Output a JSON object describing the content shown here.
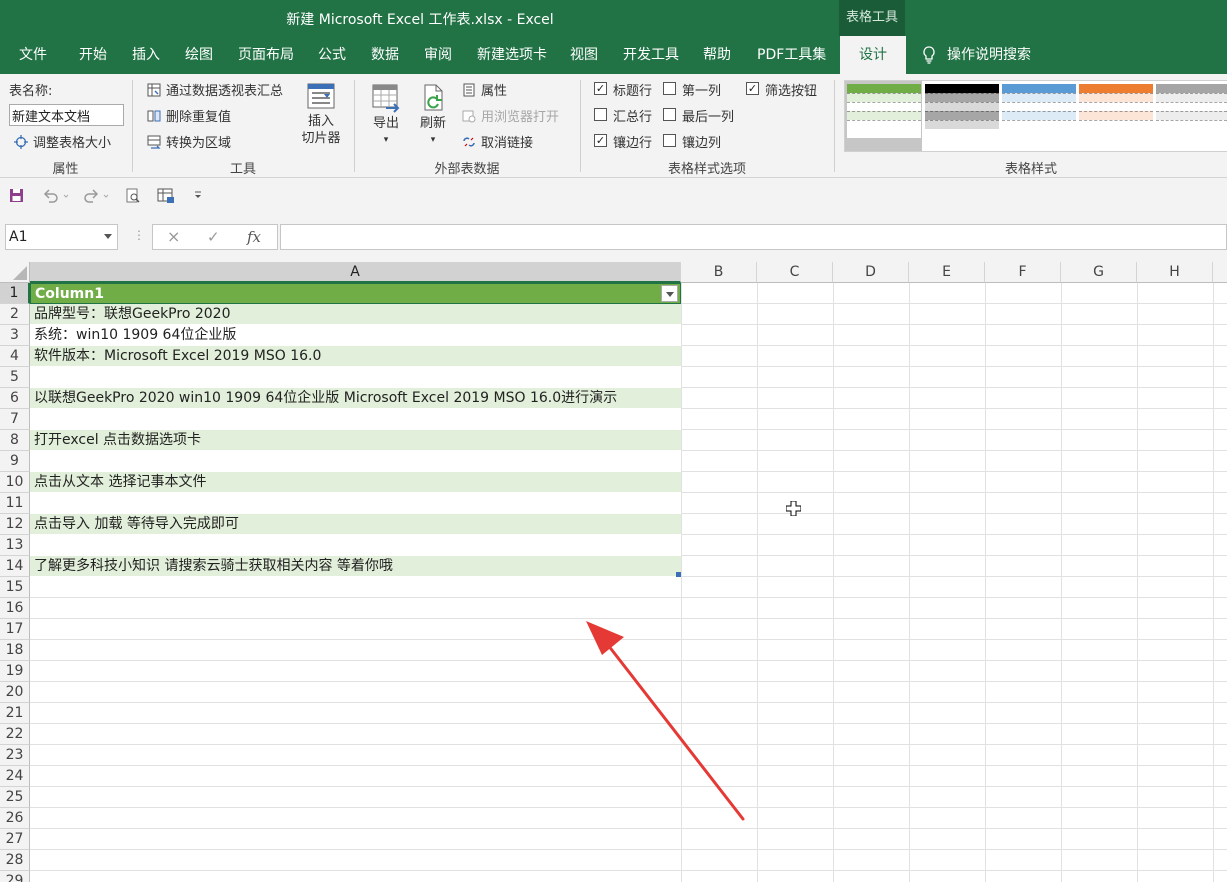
{
  "titlebar": {
    "title": "新建 Microsoft Excel 工作表.xlsx  -  Excel",
    "context_tab": "表格工具"
  },
  "tabs": [
    {
      "label": "文件"
    },
    {
      "label": "开始"
    },
    {
      "label": "插入"
    },
    {
      "label": "绘图"
    },
    {
      "label": "页面布局"
    },
    {
      "label": "公式"
    },
    {
      "label": "数据"
    },
    {
      "label": "审阅"
    },
    {
      "label": "新建选项卡"
    },
    {
      "label": "视图"
    },
    {
      "label": "开发工具"
    },
    {
      "label": "帮助"
    },
    {
      "label": "PDF工具集"
    },
    {
      "label": "设计"
    }
  ],
  "tell_me": "操作说明搜索",
  "ribbon": {
    "properties": {
      "name_label": "表名称:",
      "name_value": "新建文本文档",
      "resize": "调整表格大小",
      "group": "属性"
    },
    "tools": {
      "pivot": "通过数据透视表汇总",
      "dedupe": "删除重复值",
      "convert": "转换为区域",
      "slicer_line1": "插入",
      "slicer_line2": "切片器",
      "group": "工具"
    },
    "external": {
      "export": "导出",
      "refresh": "刷新",
      "properties": "属性",
      "open_browser": "用浏览器打开",
      "unlink": "取消链接",
      "group": "外部表数据"
    },
    "style_options": {
      "header_row": "标题行",
      "first_column": "第一列",
      "filter_button": "筛选按钮",
      "total_row": "汇总行",
      "last_column": "最后一列",
      "banded_rows": "镶边行",
      "banded_columns": "镶边列",
      "group": "表格样式选项"
    },
    "table_styles": {
      "group": "表格样式"
    }
  },
  "colors": {
    "excel_green": "#217346",
    "table_header": "#70ad47",
    "table_band": "#e2efda"
  },
  "formula_bar": {
    "name_box": "A1",
    "fx": "fx",
    "cancel": "×",
    "enter": "✓",
    "value": ""
  },
  "columns": [
    "A",
    "B",
    "C",
    "D",
    "E",
    "F",
    "G",
    "H"
  ],
  "rows": [
    {
      "n": "1",
      "a": "Column1"
    },
    {
      "n": "2",
      "a": "品牌型号：联想GeekPro 2020"
    },
    {
      "n": "3",
      "a": "系统：win10 1909 64位企业版"
    },
    {
      "n": "4",
      "a": "软件版本：Microsoft Excel 2019 MSO 16.0"
    },
    {
      "n": "5",
      "a": ""
    },
    {
      "n": "6",
      "a": "以联想GeekPro 2020 win10 1909 64位企业版  Microsoft Excel 2019 MSO 16.0进行演示"
    },
    {
      "n": "7",
      "a": ""
    },
    {
      "n": "8",
      "a": "打开excel  点击数据选项卡"
    },
    {
      "n": "9",
      "a": ""
    },
    {
      "n": "10",
      "a": "点击从文本  选择记事本文件"
    },
    {
      "n": "11",
      "a": ""
    },
    {
      "n": "12",
      "a": "点击导入   加载  等待导入完成即可"
    },
    {
      "n": "13",
      "a": ""
    },
    {
      "n": "14",
      "a": "了解更多科技小知识  请搜索云骑士获取相关内容  等着你哦"
    },
    {
      "n": "15",
      "a": ""
    },
    {
      "n": "16",
      "a": ""
    },
    {
      "n": "17",
      "a": ""
    },
    {
      "n": "18",
      "a": ""
    },
    {
      "n": "19",
      "a": ""
    },
    {
      "n": "20",
      "a": ""
    },
    {
      "n": "21",
      "a": ""
    },
    {
      "n": "22",
      "a": ""
    },
    {
      "n": "23",
      "a": ""
    },
    {
      "n": "24",
      "a": ""
    },
    {
      "n": "25",
      "a": ""
    },
    {
      "n": "26",
      "a": ""
    },
    {
      "n": "27",
      "a": ""
    },
    {
      "n": "28",
      "a": ""
    },
    {
      "n": "29",
      "a": ""
    }
  ]
}
